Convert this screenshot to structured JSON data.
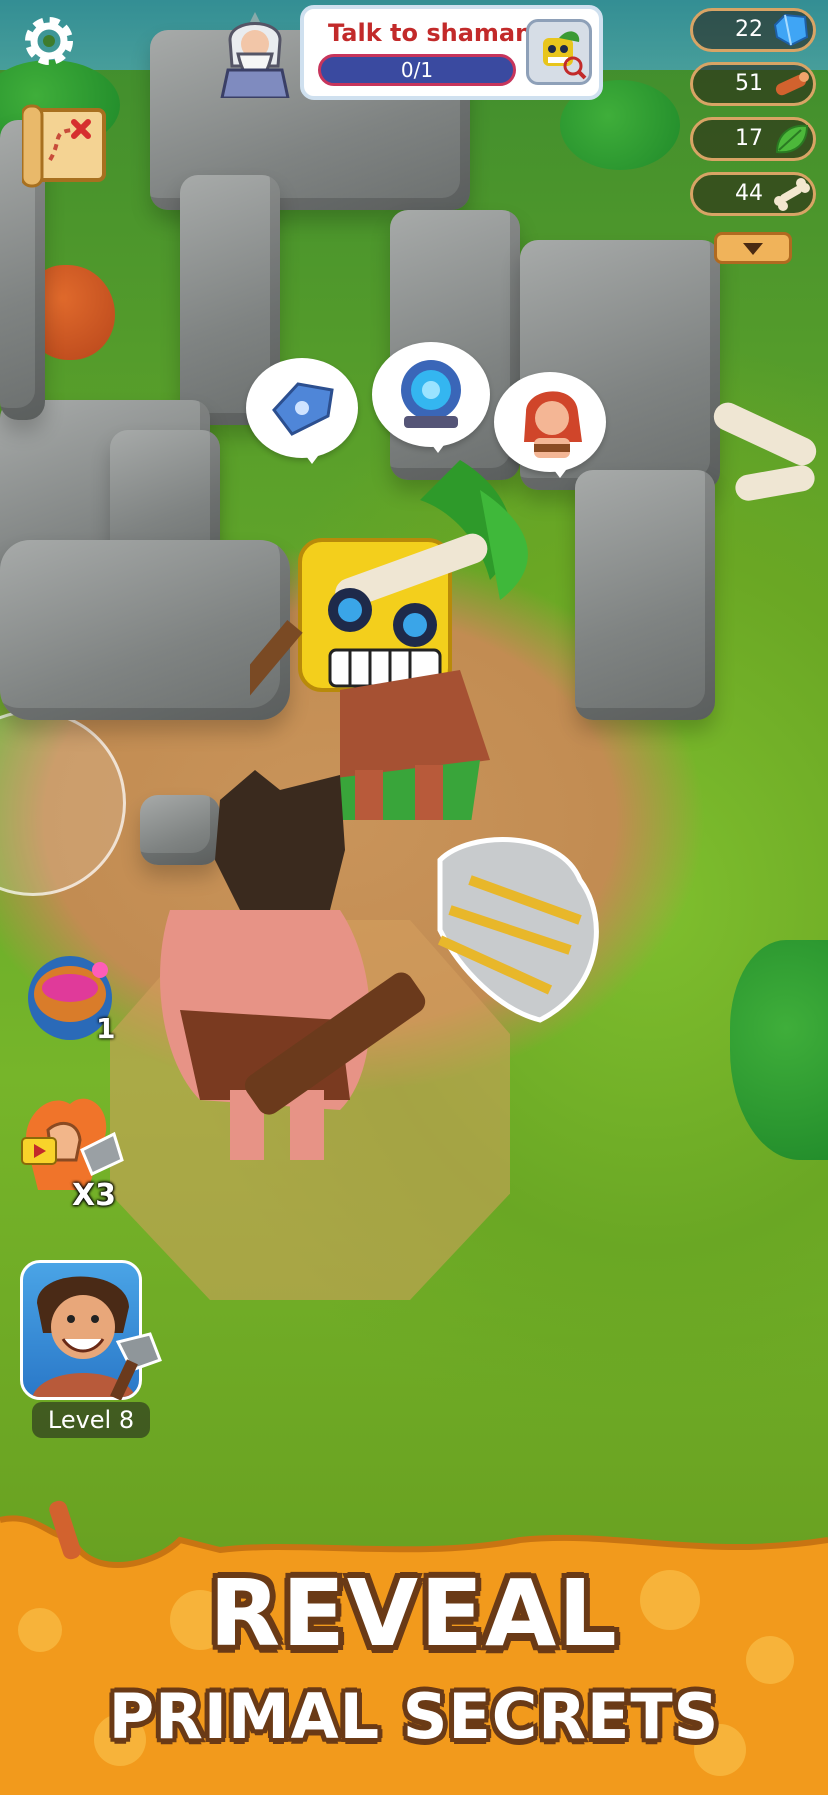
{
  "quest": {
    "title": "Talk to shaman",
    "progress_text": "0/1",
    "progress": 0
  },
  "resources": [
    {
      "value": "22",
      "icon": "blue-crystal-icon"
    },
    {
      "value": "51",
      "icon": "wood-log-icon"
    },
    {
      "value": "17",
      "icon": "leaf-icon"
    },
    {
      "value": "44",
      "icon": "bone-icon"
    }
  ],
  "left_buttons": {
    "potion_count": "1",
    "boost_label": "X3",
    "level_label": "Level 8"
  },
  "speech_bubbles": [
    "stone-tool-icon",
    "portal-icon",
    "cavewoman-icon"
  ],
  "banner": {
    "line1": "REVEAL",
    "line2": "PRIMAL SECRETS"
  },
  "colors": {
    "quest_title": "#c22a2a",
    "banner_orange": "#f29a1c",
    "banner_outline": "#6a3a16"
  }
}
